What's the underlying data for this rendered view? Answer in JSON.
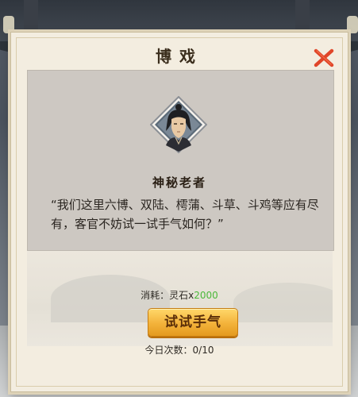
{
  "dialog": {
    "title": "博戏",
    "npc_name": "神秘老者",
    "dialogue": "“我们这里六博、双陆、樗蒲、斗草、斗鸡等应有尽有，客官不妨试一试手气如何？”",
    "cost_label": "消耗：灵石x",
    "cost_amount": "2000",
    "try_button": "试试手气",
    "count_label": "今日次数：0/10"
  },
  "icons": {
    "close": "close-icon",
    "portrait": "npc-portrait"
  },
  "colors": {
    "close_red": "#e0462a",
    "cost_green": "#4bb83a",
    "button_gold": "#f3b23a"
  }
}
